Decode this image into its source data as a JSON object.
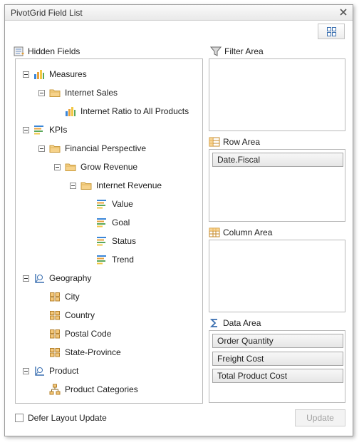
{
  "window": {
    "title": "PivotGrid Field List"
  },
  "hidden_fields": {
    "label": "Hidden Fields",
    "tree": [
      {
        "label": "Measures",
        "icon": "measures-icon"
      },
      {
        "label": "Internet Sales",
        "icon": "folder-icon"
      },
      {
        "label": "Internet Ratio to All Products",
        "icon": "measure-icon"
      },
      {
        "label": "KPIs",
        "icon": "kpi-icon"
      },
      {
        "label": "Financial Perspective",
        "icon": "folder-icon"
      },
      {
        "label": "Grow Revenue",
        "icon": "folder-icon"
      },
      {
        "label": "Internet Revenue",
        "icon": "folder-icon"
      },
      {
        "label": "Value",
        "icon": "kpi-icon"
      },
      {
        "label": "Goal",
        "icon": "kpi-icon"
      },
      {
        "label": "Status",
        "icon": "kpi-icon"
      },
      {
        "label": "Trend",
        "icon": "kpi-icon"
      },
      {
        "label": "Geography",
        "icon": "dimension-icon"
      },
      {
        "label": "City",
        "icon": "attribute-icon"
      },
      {
        "label": "Country",
        "icon": "attribute-icon"
      },
      {
        "label": "Postal Code",
        "icon": "attribute-icon"
      },
      {
        "label": "State-Province",
        "icon": "attribute-icon"
      },
      {
        "label": "Product",
        "icon": "dimension-icon"
      },
      {
        "label": "Product Categories",
        "icon": "hierarchy-icon"
      }
    ]
  },
  "filter_area": {
    "label": "Filter Area",
    "fields": []
  },
  "row_area": {
    "label": "Row Area",
    "fields": [
      "Date.Fiscal"
    ]
  },
  "column_area": {
    "label": "Column Area",
    "fields": []
  },
  "data_area": {
    "label": "Data Area",
    "fields": [
      "Order Quantity",
      "Freight Cost",
      "Total Product Cost"
    ]
  },
  "footer": {
    "defer_label": "Defer Layout Update",
    "defer_checked": false,
    "update_label": "Update"
  }
}
